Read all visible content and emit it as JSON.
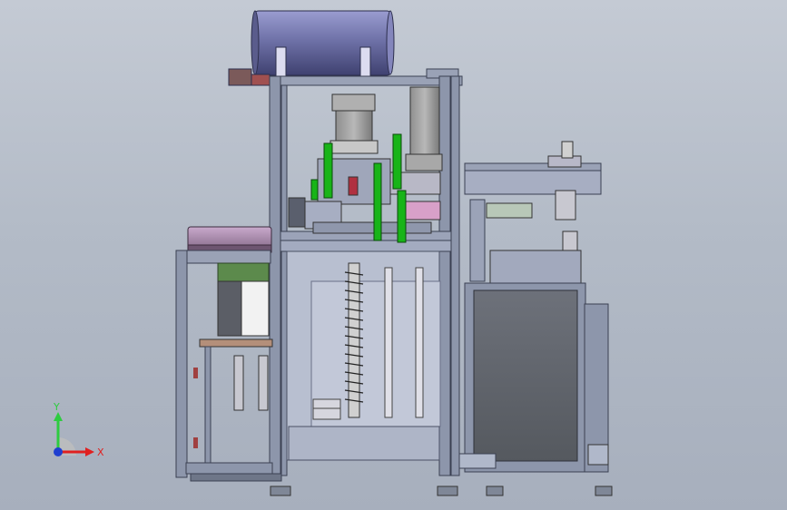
{
  "viewport": {
    "background_top": "#c4cad4",
    "background_bottom": "#a7afbd",
    "model_name": ""
  },
  "triad": {
    "y_label": "Y",
    "x_label": "X",
    "y_color": "#2ecc40",
    "x_color": "#e02020",
    "z_color": "#1f3fd0"
  },
  "palette": {
    "frame": "#8a93a6",
    "frame_dark": "#5b6275",
    "motor_purple": "#6c6fa0",
    "green_rod": "#18b418",
    "pink_plate": "#a38aa5",
    "panel_dark": "#4a4e57"
  }
}
